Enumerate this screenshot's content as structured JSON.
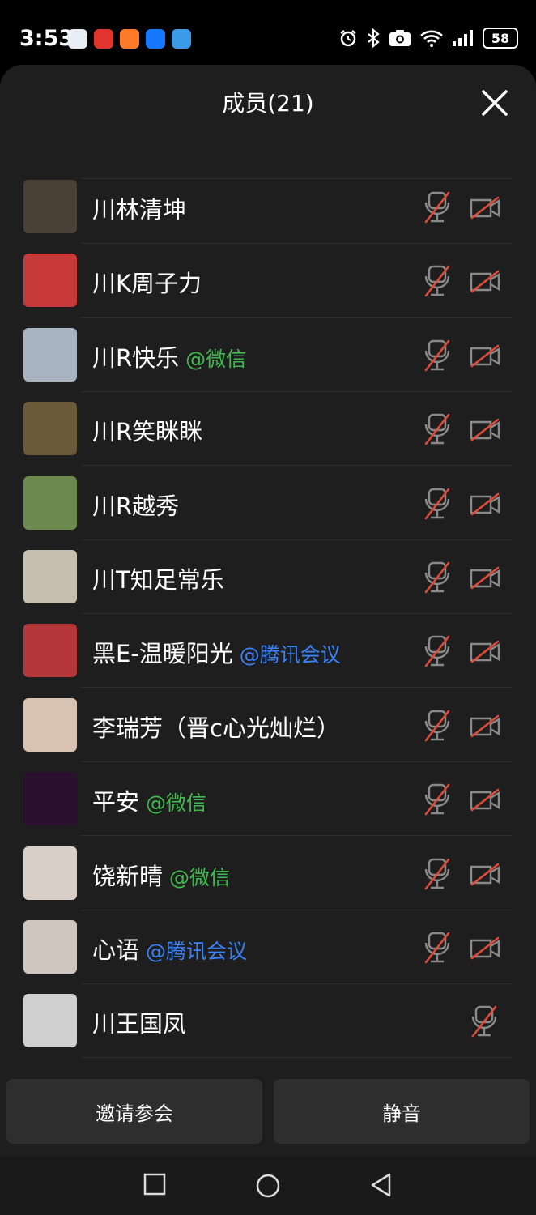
{
  "status": {
    "time": "3:53",
    "battery": "58",
    "notification_icons": [
      "qq-icon",
      "weibo-icon",
      "app-icon",
      "alipay-icon",
      "app-icon"
    ]
  },
  "sheet": {
    "title": "成员(21)"
  },
  "members": [
    {
      "name": "川林清坤",
      "tag": "",
      "tag_type": "",
      "cam": true
    },
    {
      "name": "川K周子力",
      "tag": "",
      "tag_type": "",
      "cam": true
    },
    {
      "name": "川R快乐",
      "tag": "@微信",
      "tag_type": "wx",
      "cam": true
    },
    {
      "name": "川R笑眯眯",
      "tag": "",
      "tag_type": "",
      "cam": true
    },
    {
      "name": "川R越秀",
      "tag": "",
      "tag_type": "",
      "cam": true
    },
    {
      "name": "川T知足常乐",
      "tag": "",
      "tag_type": "",
      "cam": true
    },
    {
      "name": "黑E-温暖阳光",
      "tag": "@腾讯会议",
      "tag_type": "tx",
      "cam": true
    },
    {
      "name": "李瑞芳（晋c心光灿烂）",
      "tag": "",
      "tag_type": "",
      "cam": true
    },
    {
      "name": "平安",
      "tag": "@微信",
      "tag_type": "wx",
      "cam": true
    },
    {
      "name": "饶新晴",
      "tag": "@微信",
      "tag_type": "wx",
      "cam": true
    },
    {
      "name": "心语",
      "tag": "@腾讯会议",
      "tag_type": "tx",
      "cam": true
    },
    {
      "name": "川王国凤",
      "tag": "",
      "tag_type": "",
      "cam": false
    }
  ],
  "actions": {
    "invite": "邀请参会",
    "mute": "静音"
  }
}
